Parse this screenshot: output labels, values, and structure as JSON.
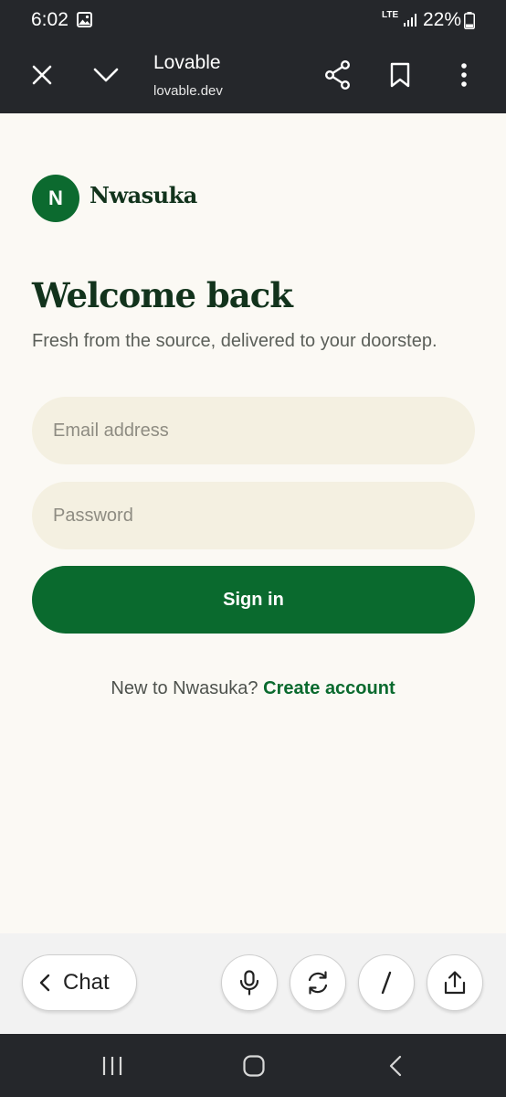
{
  "status_bar": {
    "time": "6:02",
    "network": "LTE",
    "battery": "22%"
  },
  "browser": {
    "title": "Lovable",
    "url": "lovable.dev"
  },
  "app": {
    "logo_letter": "N",
    "brand": "Nwasuka",
    "heading": "Welcome back",
    "subtitle": "Fresh from the source, delivered to your doorstep.",
    "email_placeholder": "Email address",
    "password_placeholder": "Password",
    "signin_label": "Sign in",
    "signup_prompt": "New to Nwasuka?",
    "signup_link": "Create account"
  },
  "toolbar": {
    "chat_label": "Chat"
  },
  "colors": {
    "primary": "#0a6a2e",
    "background": "#fbf9f4",
    "input": "#f4f0e1",
    "dark_bar": "#25272b"
  },
  "icons": [
    "gallery-icon",
    "signal-icon",
    "battery-icon",
    "close-icon",
    "chevron-down-icon",
    "share-icon",
    "bookmark-icon",
    "more-vertical-icon",
    "chevron-left-icon",
    "microphone-icon",
    "refresh-icon",
    "slash-icon",
    "upload-icon",
    "recents-icon",
    "home-icon",
    "back-icon"
  ]
}
